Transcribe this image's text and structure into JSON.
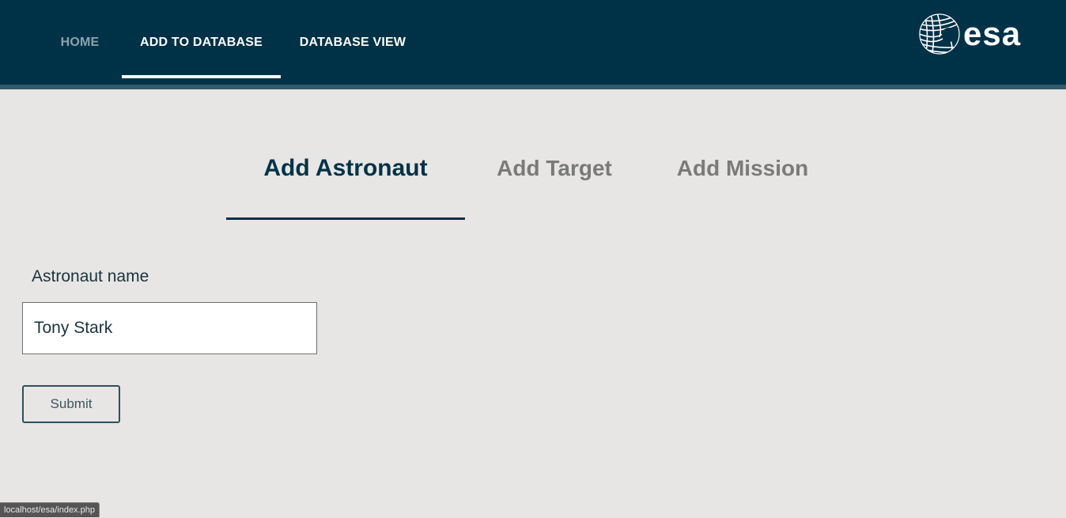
{
  "nav": {
    "home": "HOME",
    "add_to_database": "ADD TO DATABASE",
    "database_view": "DATABASE VIEW",
    "active": "ADD TO DATABASE"
  },
  "logo": {
    "text": "esa",
    "icon": "esa-globe-icon"
  },
  "subtabs": {
    "astronaut": "Add Astronaut",
    "target": "Add Target",
    "mission": "Add Mission",
    "active": "Add Astronaut"
  },
  "form": {
    "label": "Astronaut name",
    "value": "Tony Stark",
    "submit": "Submit"
  },
  "status_bar": {
    "url": "localhost/esa/index.php"
  },
  "colors": {
    "header_bg": "#003247",
    "page_bg": "#e8e6e4",
    "active_tab": "#003247",
    "inactive_tab": "#7a7a7a"
  }
}
